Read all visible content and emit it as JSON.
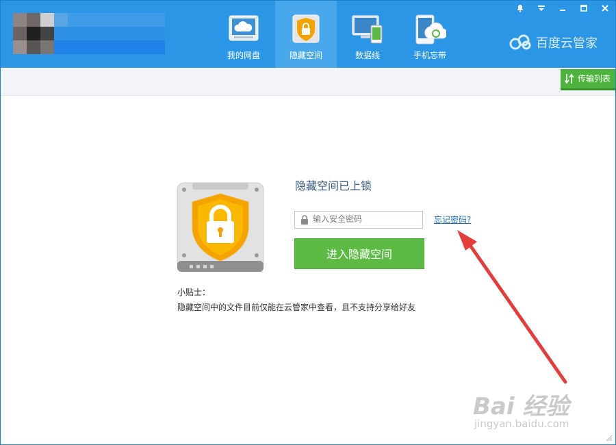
{
  "nav": {
    "tabs": [
      {
        "label": "我的网盘",
        "icon": "cloud-drive-icon",
        "active": false
      },
      {
        "label": "隐藏空间",
        "icon": "lock-shield-icon",
        "active": true
      },
      {
        "label": "数据线",
        "icon": "monitor-phone-icon",
        "active": false
      },
      {
        "label": "手机忘带",
        "icon": "phone-sync-icon",
        "active": false
      }
    ]
  },
  "brand": {
    "name": "百度云管家",
    "icon": "baidu-cloud-logo-icon"
  },
  "window_controls": [
    "bell-icon",
    "dropdown-icon",
    "minimize-icon",
    "maximize-icon",
    "close-icon"
  ],
  "toolbar": {
    "transfer_label": "传输列表"
  },
  "lock_panel": {
    "title": "隐藏空间已上锁",
    "password_placeholder": "输入安全密码",
    "password_value": "",
    "forgot_label": "忘记密码?",
    "enter_label": "进入隐藏空间",
    "tip_title": "小贴士：",
    "tip_text": "隐藏空间中的文件目前仅能在云管家中查看，且不支持分享给好友"
  },
  "watermark": {
    "line1": "Bai 经验",
    "line2": "jingyan.baidu.com"
  },
  "colors": {
    "header": "#2b95e6",
    "active_tab": "#49a8ec",
    "primary_button": "#5cb943",
    "link": "#1f6fb9",
    "annotation_arrow": "#e63c3c"
  }
}
